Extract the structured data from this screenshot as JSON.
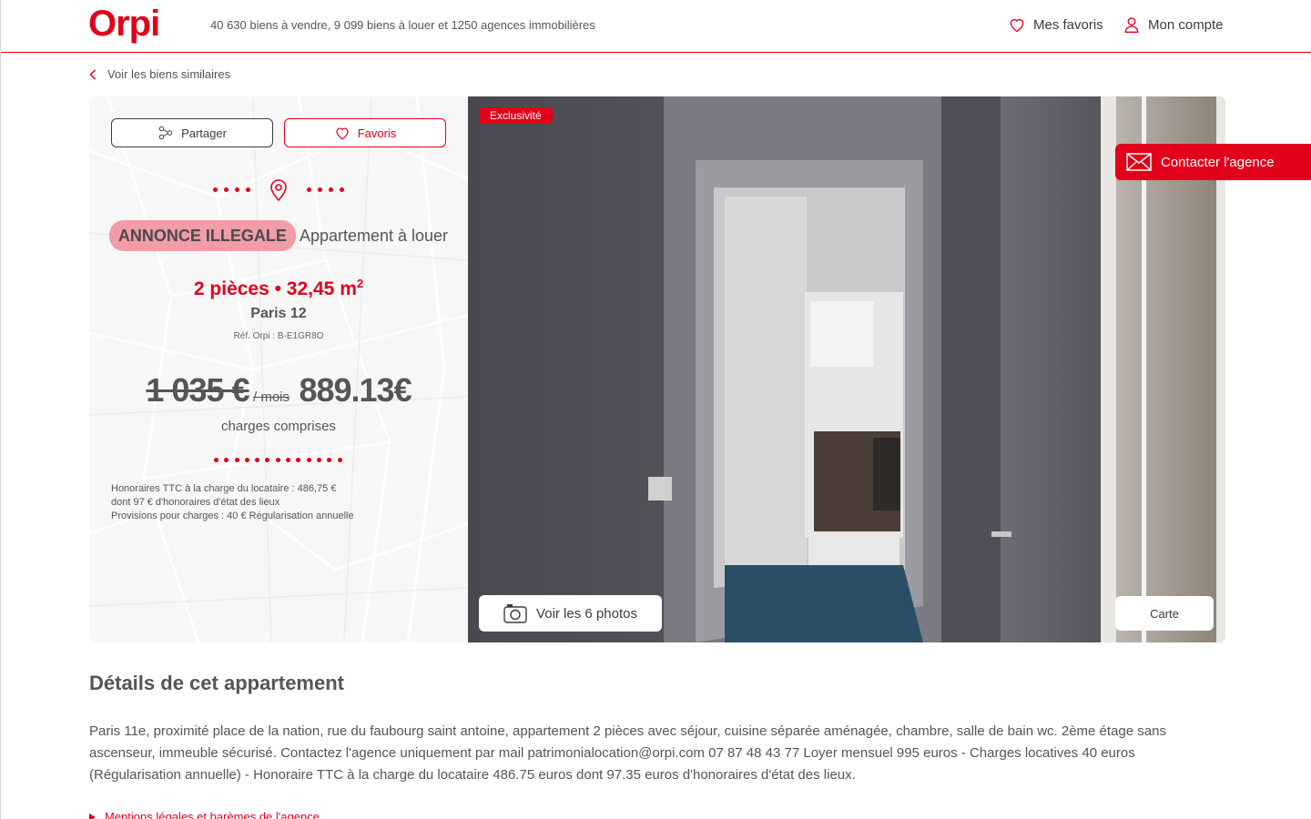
{
  "header": {
    "logo": "Orpi",
    "stats": "40 630 biens à vendre, 9 099 biens à louer et 1250 agences immobilières",
    "favorites_label": "Mes favoris",
    "account_label": "Mon compte"
  },
  "breadcrumb": {
    "back_label": "Voir les biens similaires"
  },
  "listing": {
    "share_label": "Partager",
    "fav_label": "Favoris",
    "badge": "ANNONCE ILLEGALE",
    "type": "Appartement à louer",
    "specs": "2 pièces • 32,45 m",
    "specs_sup": "2",
    "city": "Paris 12",
    "ref": "Réf. Orpi : B-E1GR8O",
    "old_price": "1 035 €",
    "per_month": "/ mois",
    "new_price": "889.13€",
    "charges": "charges comprises",
    "fees": [
      "Honoraires TTC à la charge du locataire : 486,75 €",
      "dont 97 € d'honoraires d'état des lieux",
      "Provisions pour charges : 40 € Régularisation annuelle"
    ]
  },
  "photo": {
    "exclusive_label": "Exclusivité",
    "photos_label": "Voir les 6 photos",
    "map_label": "Carte"
  },
  "contact_label": "Contacter l'agence",
  "details": {
    "title": "Détails de cet appartement",
    "text": "Paris 11e, proximité place de la nation, rue du faubourg saint antoine, appartement 2 pièces avec séjour, cuisine séparée aménagée, chambre, salle de bain wc. 2ème étage sans ascenseur, immeuble sécurisé. Contactez l'agence uniquement par mail patrimonialocation@orpi.com 07 87 48 43 77 Loyer mensuel 995 euros - Charges locatives 40 euros (Régularisation annuelle) - Honoraire TTC à la charge du locataire 486.75 euros dont 97.35 euros d'honoraires d'état des lieux.",
    "legal_label": "Mentions légales et barèmes de l'agence"
  },
  "colors": {
    "accent": "#e2001a",
    "badge_bg": "#f19ca7",
    "text": "#555555"
  },
  "icons": [
    "heart-icon",
    "user-icon",
    "chevron-left-icon",
    "share-icon",
    "location-pin-icon",
    "camera-icon",
    "mail-icon"
  ]
}
